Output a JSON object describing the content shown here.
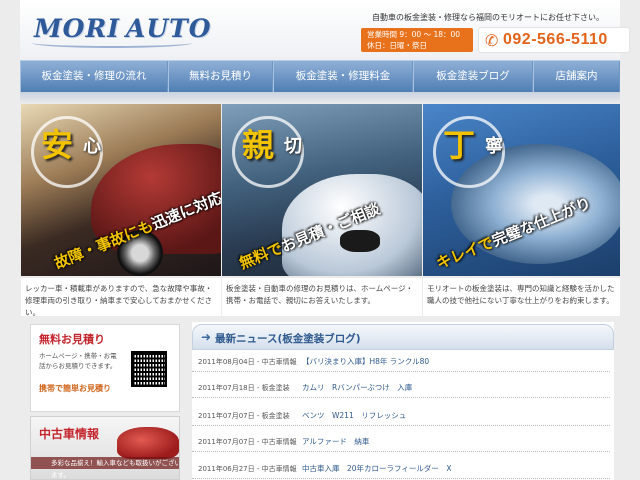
{
  "header": {
    "logo_word1": "MORI",
    "logo_word2": "AUTO",
    "tagline": "自動車の板金塗装・修理なら福岡のモリオートにお任せ下さい。",
    "hours_line1": "営業時間 9：00 ～ 18：00",
    "hours_line2": "休日：日曜・祭日",
    "phone": "092-566-5110"
  },
  "nav": {
    "items": [
      {
        "label": "板金塗装・修理の流れ"
      },
      {
        "label": "無料お見積り"
      },
      {
        "label": "板金塗装・修理料金"
      },
      {
        "label": "板金塗装ブログ"
      },
      {
        "label": "店舗案内"
      }
    ]
  },
  "hero": {
    "panels": [
      {
        "kanji_big": "安",
        "kanji_small": "心",
        "tag_lead": "故障・事故にも",
        "tag_rest": "迅速に対応",
        "description": "レッカー車・積載車がありますので、急な故障や事故・修理車両の引き取り・納車まで安心しておまかせください。"
      },
      {
        "kanji_big": "親",
        "kanji_small": "切",
        "tag_lead": "無料で",
        "tag_rest": "お見積・ご相談",
        "description": "板金塗装・自動車の修理のお見積りは、ホームページ・携帯・お電話で、親切にお答えいたします。"
      },
      {
        "kanji_big": "丁",
        "kanji_small": "寧",
        "tag_lead": "キレイで",
        "tag_rest": "完璧な仕上がり",
        "description": "モリオートの板金塗装は、専門の知識と経験を活かした職人の技で他社にない丁寧な仕上がりをお約束します。"
      }
    ]
  },
  "sidebar": {
    "estimate": {
      "title": "無料お見積り",
      "text": "ホームページ・携帯・お電話からお見積りできます。",
      "link": "携帯で簡単お見積り"
    },
    "used_car": {
      "title": "中古車情報",
      "caption": "多彩な品揃え！輸入車なども取扱いがございます。"
    }
  },
  "news": {
    "title": "最新ニュース(板金塗装ブログ)",
    "items": [
      {
        "date": "2011年08月04日 - 中古車情報",
        "text": "【バリ決まり入庫】H8年 ランクル80"
      },
      {
        "date": "2011年07月18日 - 板金塗装",
        "text": "カムリ　Rバンパーぶつけ　入庫"
      },
      {
        "date": "2011年07月07日 - 板金塗装",
        "text": "ベンツ　W211　リフレッシュ"
      },
      {
        "date": "2011年07月07日 - 中古車情報",
        "text": "アルファード　納車"
      },
      {
        "date": "2011年06月27日 - 中古車情報",
        "text": "中古車入庫　20年カローラフィールダー　X"
      }
    ]
  },
  "colors": {
    "accent_orange": "#e8711b",
    "nav_blue": "#4f7eb4",
    "news_blue": "#2f5a8e",
    "red_title": "#c4262e"
  },
  "icons": [
    "phone-icon",
    "arrow-right-icon",
    "qr-code-icon"
  ]
}
